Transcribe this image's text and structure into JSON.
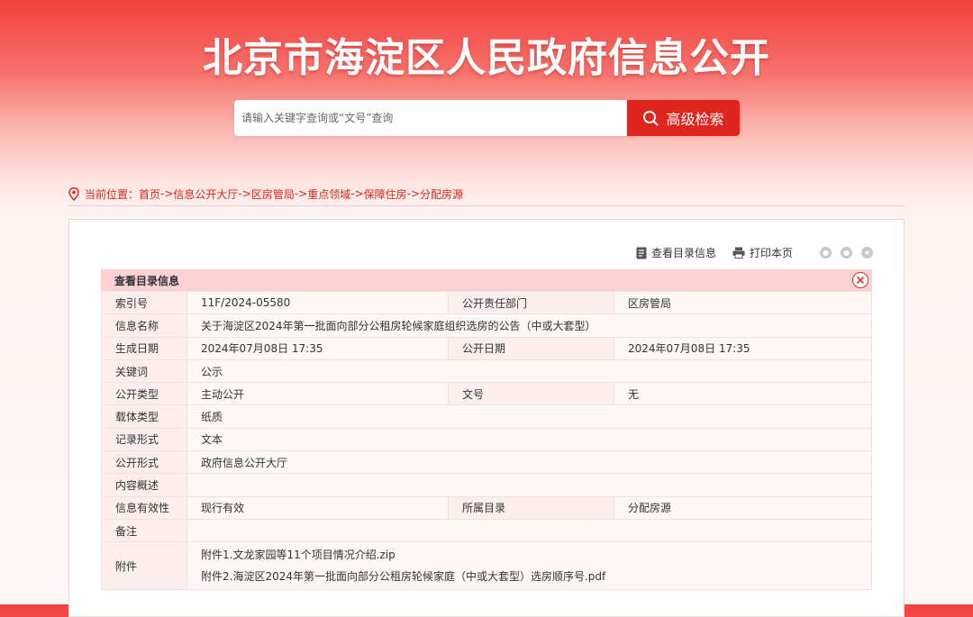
{
  "site": {
    "title": "北京市海淀区人民政府信息公开"
  },
  "search": {
    "placeholder": "请输入关键字查询或“文号”查询",
    "button_label": "高级检索"
  },
  "breadcrumb": {
    "prefix": "当前位置：",
    "items": [
      "首页",
      "信息公开大厅",
      "区房管局",
      "重点领域",
      "保障住房",
      "分配房源"
    ],
    "separator": "->"
  },
  "toolbar": {
    "view_catalog": "查看目录信息",
    "print": "打印本页"
  },
  "info": {
    "heading": "查看目录信息",
    "index_label": "索引号",
    "index_value": "11F/2024-05580",
    "dept_label": "公开责任部门",
    "dept_value": "区房管局",
    "name_label": "信息名称",
    "name_value": "关于海淀区2024年第一批面向部分公租房轮候家庭组织选房的公告（中或大套型）",
    "gen_date_label": "生成日期",
    "gen_date_value": "2024年07月08日 17:35",
    "pub_date_label": "公开日期",
    "pub_date_value": "2024年07月08日 17:35",
    "keyword_label": "关键词",
    "keyword_value": "公示",
    "pub_type_label": "公开类型",
    "pub_type_value": "主动公开",
    "doc_no_label": "文号",
    "doc_no_value": "无",
    "carrier_label": "载体类型",
    "carrier_value": "纸质",
    "record_label": "记录形式",
    "record_value": "文本",
    "pub_form_label": "公开形式",
    "pub_form_value": "政府信息公开大厅",
    "summary_label": "内容概述",
    "summary_value": "",
    "validity_label": "信息有效性",
    "validity_value": "现行有效",
    "catalog_label": "所属目录",
    "catalog_value": "分配房源",
    "remark_label": "备注",
    "remark_value": "",
    "attach_label": "附件",
    "attachments": [
      "附件1.文龙家园等11个项目情况介绍.zip",
      "附件2.海淀区2024年第一批面向部分公租房轮候家庭（中或大套型）选房顺序号.pdf"
    ]
  },
  "colors": {
    "accent": "#e0251f",
    "link": "#d6281f",
    "header_bg": "#f9d2d1"
  }
}
